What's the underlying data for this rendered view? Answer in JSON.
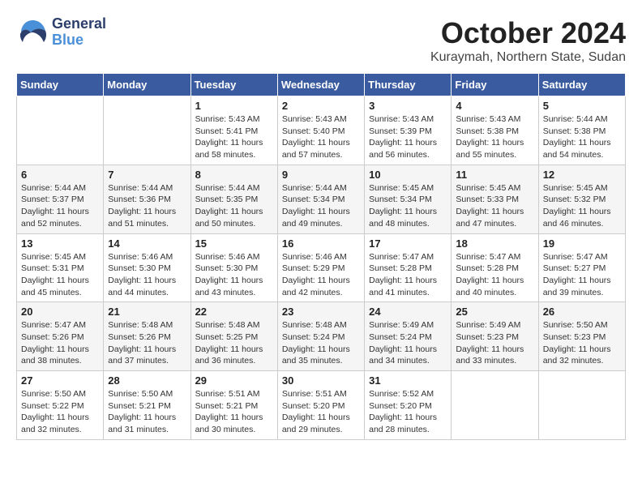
{
  "header": {
    "logo_general": "General",
    "logo_blue": "Blue",
    "month": "October 2024",
    "location": "Kuraymah, Northern State, Sudan"
  },
  "days_of_week": [
    "Sunday",
    "Monday",
    "Tuesday",
    "Wednesday",
    "Thursday",
    "Friday",
    "Saturday"
  ],
  "weeks": [
    [
      {
        "day": "",
        "info": ""
      },
      {
        "day": "",
        "info": ""
      },
      {
        "day": "1",
        "info": "Sunrise: 5:43 AM\nSunset: 5:41 PM\nDaylight: 11 hours and 58 minutes."
      },
      {
        "day": "2",
        "info": "Sunrise: 5:43 AM\nSunset: 5:40 PM\nDaylight: 11 hours and 57 minutes."
      },
      {
        "day": "3",
        "info": "Sunrise: 5:43 AM\nSunset: 5:39 PM\nDaylight: 11 hours and 56 minutes."
      },
      {
        "day": "4",
        "info": "Sunrise: 5:43 AM\nSunset: 5:38 PM\nDaylight: 11 hours and 55 minutes."
      },
      {
        "day": "5",
        "info": "Sunrise: 5:44 AM\nSunset: 5:38 PM\nDaylight: 11 hours and 54 minutes."
      }
    ],
    [
      {
        "day": "6",
        "info": "Sunrise: 5:44 AM\nSunset: 5:37 PM\nDaylight: 11 hours and 52 minutes."
      },
      {
        "day": "7",
        "info": "Sunrise: 5:44 AM\nSunset: 5:36 PM\nDaylight: 11 hours and 51 minutes."
      },
      {
        "day": "8",
        "info": "Sunrise: 5:44 AM\nSunset: 5:35 PM\nDaylight: 11 hours and 50 minutes."
      },
      {
        "day": "9",
        "info": "Sunrise: 5:44 AM\nSunset: 5:34 PM\nDaylight: 11 hours and 49 minutes."
      },
      {
        "day": "10",
        "info": "Sunrise: 5:45 AM\nSunset: 5:34 PM\nDaylight: 11 hours and 48 minutes."
      },
      {
        "day": "11",
        "info": "Sunrise: 5:45 AM\nSunset: 5:33 PM\nDaylight: 11 hours and 47 minutes."
      },
      {
        "day": "12",
        "info": "Sunrise: 5:45 AM\nSunset: 5:32 PM\nDaylight: 11 hours and 46 minutes."
      }
    ],
    [
      {
        "day": "13",
        "info": "Sunrise: 5:45 AM\nSunset: 5:31 PM\nDaylight: 11 hours and 45 minutes."
      },
      {
        "day": "14",
        "info": "Sunrise: 5:46 AM\nSunset: 5:30 PM\nDaylight: 11 hours and 44 minutes."
      },
      {
        "day": "15",
        "info": "Sunrise: 5:46 AM\nSunset: 5:30 PM\nDaylight: 11 hours and 43 minutes."
      },
      {
        "day": "16",
        "info": "Sunrise: 5:46 AM\nSunset: 5:29 PM\nDaylight: 11 hours and 42 minutes."
      },
      {
        "day": "17",
        "info": "Sunrise: 5:47 AM\nSunset: 5:28 PM\nDaylight: 11 hours and 41 minutes."
      },
      {
        "day": "18",
        "info": "Sunrise: 5:47 AM\nSunset: 5:28 PM\nDaylight: 11 hours and 40 minutes."
      },
      {
        "day": "19",
        "info": "Sunrise: 5:47 AM\nSunset: 5:27 PM\nDaylight: 11 hours and 39 minutes."
      }
    ],
    [
      {
        "day": "20",
        "info": "Sunrise: 5:47 AM\nSunset: 5:26 PM\nDaylight: 11 hours and 38 minutes."
      },
      {
        "day": "21",
        "info": "Sunrise: 5:48 AM\nSunset: 5:26 PM\nDaylight: 11 hours and 37 minutes."
      },
      {
        "day": "22",
        "info": "Sunrise: 5:48 AM\nSunset: 5:25 PM\nDaylight: 11 hours and 36 minutes."
      },
      {
        "day": "23",
        "info": "Sunrise: 5:48 AM\nSunset: 5:24 PM\nDaylight: 11 hours and 35 minutes."
      },
      {
        "day": "24",
        "info": "Sunrise: 5:49 AM\nSunset: 5:24 PM\nDaylight: 11 hours and 34 minutes."
      },
      {
        "day": "25",
        "info": "Sunrise: 5:49 AM\nSunset: 5:23 PM\nDaylight: 11 hours and 33 minutes."
      },
      {
        "day": "26",
        "info": "Sunrise: 5:50 AM\nSunset: 5:23 PM\nDaylight: 11 hours and 32 minutes."
      }
    ],
    [
      {
        "day": "27",
        "info": "Sunrise: 5:50 AM\nSunset: 5:22 PM\nDaylight: 11 hours and 32 minutes."
      },
      {
        "day": "28",
        "info": "Sunrise: 5:50 AM\nSunset: 5:21 PM\nDaylight: 11 hours and 31 minutes."
      },
      {
        "day": "29",
        "info": "Sunrise: 5:51 AM\nSunset: 5:21 PM\nDaylight: 11 hours and 30 minutes."
      },
      {
        "day": "30",
        "info": "Sunrise: 5:51 AM\nSunset: 5:20 PM\nDaylight: 11 hours and 29 minutes."
      },
      {
        "day": "31",
        "info": "Sunrise: 5:52 AM\nSunset: 5:20 PM\nDaylight: 11 hours and 28 minutes."
      },
      {
        "day": "",
        "info": ""
      },
      {
        "day": "",
        "info": ""
      }
    ]
  ]
}
